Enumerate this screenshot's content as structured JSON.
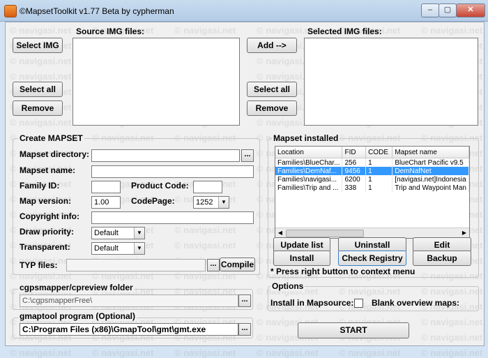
{
  "window": {
    "title": "©MapsetToolkit v1.77 Beta by cypherman"
  },
  "source": {
    "label": "Source IMG files:",
    "select_img": "Select IMG",
    "select_all": "Select all",
    "remove": "Remove"
  },
  "middle": {
    "add": "Add -->"
  },
  "selected": {
    "label": "Selected IMG files:",
    "select_all": "Select all",
    "remove": "Remove"
  },
  "create": {
    "title": "Create MAPSET",
    "mapset_directory": "Mapset directory:",
    "mapset_name": "Mapset name:",
    "family_id": "Family ID:",
    "product_code": "Product Code:",
    "map_version": "Map version:",
    "map_version_value": "1.00",
    "codepage": "CodePage:",
    "codepage_value": "1252",
    "copyright": "Copyright info:",
    "draw_priority": "Draw priority:",
    "draw_priority_value": "Default",
    "transparent": "Transparent:",
    "transparent_value": "Default",
    "typ_files": "TYP files:",
    "compile": "Compile",
    "browse": "..."
  },
  "installed": {
    "title": "Mapset installed",
    "columns": [
      "Location",
      "FID",
      "CODE",
      "Mapset name"
    ],
    "rows": [
      [
        "Families\\BlueChar...",
        "256",
        "1",
        "BlueChart Pacific v9.5"
      ],
      [
        "Families\\DemNaf...",
        "9456",
        "1",
        "DemNafNet"
      ],
      [
        "Families\\navigasi...",
        "6200",
        "1",
        "[navigasi.net]Indonesia"
      ],
      [
        "Families\\Trip and ...",
        "338",
        "1",
        "Trip and Waypoint Man"
      ]
    ],
    "selected_row": 1,
    "update_list": "Update list",
    "install": "Install",
    "uninstall": "Uninstall",
    "check_registry": "Check Registry",
    "edit": "Edit",
    "backup": "Backup",
    "hint": "* Press right button to context menu"
  },
  "cgps": {
    "title": "cgpsmapper/cpreview folder",
    "path": "C:\\cgpsmapperFree\\"
  },
  "gmaptool": {
    "title": "gmaptool program (Optional)",
    "path": "C:\\Program Files (x86)\\GmapTool\\gmt\\gmt.exe"
  },
  "options": {
    "title": "Options",
    "install_in_mapsource": "Install in Mapsource:",
    "blank_overview": "Blank overview maps:"
  },
  "start": "START",
  "watermark": "navigasi.net",
  "colors": {
    "selection": "#3399ff",
    "titlebar": "#c9dcef"
  }
}
